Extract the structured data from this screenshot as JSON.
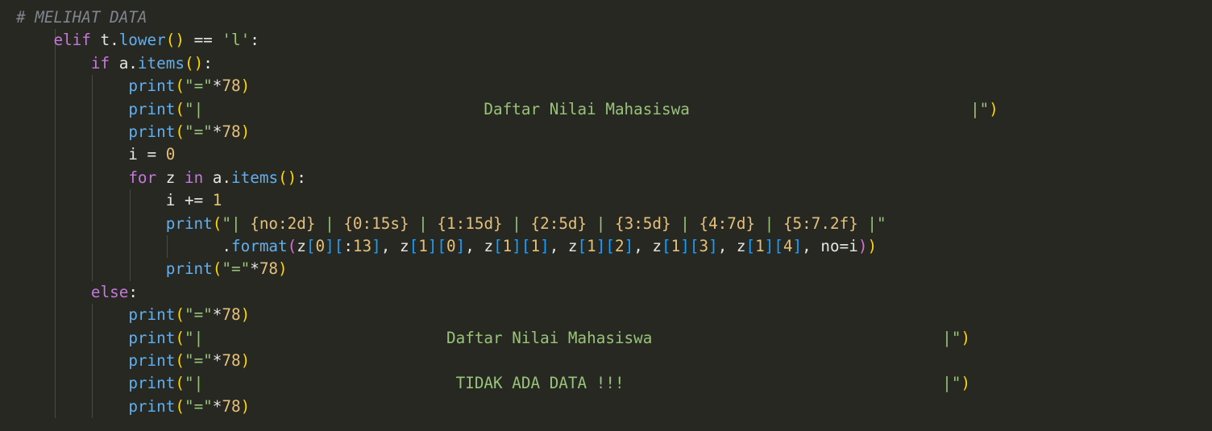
{
  "theme": {
    "background": "#272822",
    "indent_guide": "#4a4a40",
    "token_colors": {
      "keyword": "#c678dd",
      "function": "#61afef",
      "identifier": "#e5e5e5",
      "number": "#e5c07b",
      "string": "#98c379",
      "bracket_1": "#ffd700",
      "bracket_2": "#da70d6",
      "bracket_3": "#179fff",
      "comment": "#7f848e"
    }
  },
  "code": {
    "lines": [
      [
        {
          "t": "# MELIHAT DATA",
          "c": "#7f848e",
          "i": true
        }
      ],
      [
        {
          "t": "    ",
          "c": "#e5e5e5"
        },
        {
          "t": "elif",
          "c": "#c678dd"
        },
        {
          "t": " t.",
          "c": "#e5e5e5"
        },
        {
          "t": "lower",
          "c": "#61afef"
        },
        {
          "t": "()",
          "c": "#ffd700"
        },
        {
          "t": " == ",
          "c": "#e5e5e5"
        },
        {
          "t": "'l'",
          "c": "#98c379"
        },
        {
          "t": ":",
          "c": "#e5e5e5"
        }
      ],
      [
        {
          "t": "        ",
          "c": "#e5e5e5"
        },
        {
          "t": "if",
          "c": "#c678dd"
        },
        {
          "t": " a.",
          "c": "#e5e5e5"
        },
        {
          "t": "items",
          "c": "#61afef"
        },
        {
          "t": "()",
          "c": "#ffd700"
        },
        {
          "t": ":",
          "c": "#e5e5e5"
        }
      ],
      [
        {
          "t": "            ",
          "c": "#e5e5e5"
        },
        {
          "t": "print",
          "c": "#61afef"
        },
        {
          "t": "(",
          "c": "#ffd700"
        },
        {
          "t": "\"=\"",
          "c": "#98c379"
        },
        {
          "t": "*",
          "c": "#e5e5e5"
        },
        {
          "t": "78",
          "c": "#e5c07b"
        },
        {
          "t": ")",
          "c": "#ffd700"
        }
      ],
      [
        {
          "t": "            ",
          "c": "#e5e5e5"
        },
        {
          "t": "print",
          "c": "#61afef"
        },
        {
          "t": "(",
          "c": "#ffd700"
        },
        {
          "t": "\"|                              Daftar Nilai Mahasiswa                              |\"",
          "c": "#98c379"
        },
        {
          "t": ")",
          "c": "#ffd700"
        }
      ],
      [
        {
          "t": "            ",
          "c": "#e5e5e5"
        },
        {
          "t": "print",
          "c": "#61afef"
        },
        {
          "t": "(",
          "c": "#ffd700"
        },
        {
          "t": "\"=\"",
          "c": "#98c379"
        },
        {
          "t": "*",
          "c": "#e5e5e5"
        },
        {
          "t": "78",
          "c": "#e5c07b"
        },
        {
          "t": ")",
          "c": "#ffd700"
        }
      ],
      [
        {
          "t": "            i = ",
          "c": "#e5e5e5"
        },
        {
          "t": "0",
          "c": "#e5c07b"
        }
      ],
      [
        {
          "t": "            ",
          "c": "#e5e5e5"
        },
        {
          "t": "for",
          "c": "#c678dd"
        },
        {
          "t": " z ",
          "c": "#e5e5e5"
        },
        {
          "t": "in",
          "c": "#c678dd"
        },
        {
          "t": " a.",
          "c": "#e5e5e5"
        },
        {
          "t": "items",
          "c": "#61afef"
        },
        {
          "t": "()",
          "c": "#ffd700"
        },
        {
          "t": ":",
          "c": "#e5e5e5"
        }
      ],
      [
        {
          "t": "                i += ",
          "c": "#e5e5e5"
        },
        {
          "t": "1",
          "c": "#e5c07b"
        }
      ],
      [
        {
          "t": "                ",
          "c": "#e5e5e5"
        },
        {
          "t": "print",
          "c": "#61afef"
        },
        {
          "t": "(",
          "c": "#ffd700"
        },
        {
          "t": "\"| ",
          "c": "#98c379"
        },
        {
          "t": "{no:2d}",
          "c": "#e5c07b"
        },
        {
          "t": " | ",
          "c": "#98c379"
        },
        {
          "t": "{0:15s}",
          "c": "#e5c07b"
        },
        {
          "t": " | ",
          "c": "#98c379"
        },
        {
          "t": "{1:15d}",
          "c": "#e5c07b"
        },
        {
          "t": " | ",
          "c": "#98c379"
        },
        {
          "t": "{2:5d}",
          "c": "#e5c07b"
        },
        {
          "t": " | ",
          "c": "#98c379"
        },
        {
          "t": "{3:5d}",
          "c": "#e5c07b"
        },
        {
          "t": " | ",
          "c": "#98c379"
        },
        {
          "t": "{4:7d}",
          "c": "#e5c07b"
        },
        {
          "t": " | ",
          "c": "#98c379"
        },
        {
          "t": "{5:7.2f}",
          "c": "#e5c07b"
        },
        {
          "t": " |\"",
          "c": "#98c379"
        }
      ],
      [
        {
          "t": "                      .",
          "c": "#e5e5e5"
        },
        {
          "t": "format",
          "c": "#61afef"
        },
        {
          "t": "(",
          "c": "#da70d6"
        },
        {
          "t": "z",
          "c": "#e5e5e5"
        },
        {
          "t": "[",
          "c": "#179fff"
        },
        {
          "t": "0",
          "c": "#e5c07b"
        },
        {
          "t": "]",
          "c": "#179fff"
        },
        {
          "t": "[",
          "c": "#179fff"
        },
        {
          "t": ":",
          "c": "#e5e5e5"
        },
        {
          "t": "13",
          "c": "#e5c07b"
        },
        {
          "t": "]",
          "c": "#179fff"
        },
        {
          "t": ", z",
          "c": "#e5e5e5"
        },
        {
          "t": "[",
          "c": "#179fff"
        },
        {
          "t": "1",
          "c": "#e5c07b"
        },
        {
          "t": "]",
          "c": "#179fff"
        },
        {
          "t": "[",
          "c": "#179fff"
        },
        {
          "t": "0",
          "c": "#e5c07b"
        },
        {
          "t": "]",
          "c": "#179fff"
        },
        {
          "t": ", z",
          "c": "#e5e5e5"
        },
        {
          "t": "[",
          "c": "#179fff"
        },
        {
          "t": "1",
          "c": "#e5c07b"
        },
        {
          "t": "]",
          "c": "#179fff"
        },
        {
          "t": "[",
          "c": "#179fff"
        },
        {
          "t": "1",
          "c": "#e5c07b"
        },
        {
          "t": "]",
          "c": "#179fff"
        },
        {
          "t": ", z",
          "c": "#e5e5e5"
        },
        {
          "t": "[",
          "c": "#179fff"
        },
        {
          "t": "1",
          "c": "#e5c07b"
        },
        {
          "t": "]",
          "c": "#179fff"
        },
        {
          "t": "[",
          "c": "#179fff"
        },
        {
          "t": "2",
          "c": "#e5c07b"
        },
        {
          "t": "]",
          "c": "#179fff"
        },
        {
          "t": ", z",
          "c": "#e5e5e5"
        },
        {
          "t": "[",
          "c": "#179fff"
        },
        {
          "t": "1",
          "c": "#e5c07b"
        },
        {
          "t": "]",
          "c": "#179fff"
        },
        {
          "t": "[",
          "c": "#179fff"
        },
        {
          "t": "3",
          "c": "#e5c07b"
        },
        {
          "t": "]",
          "c": "#179fff"
        },
        {
          "t": ", z",
          "c": "#e5e5e5"
        },
        {
          "t": "[",
          "c": "#179fff"
        },
        {
          "t": "1",
          "c": "#e5c07b"
        },
        {
          "t": "]",
          "c": "#179fff"
        },
        {
          "t": "[",
          "c": "#179fff"
        },
        {
          "t": "4",
          "c": "#e5c07b"
        },
        {
          "t": "]",
          "c": "#179fff"
        },
        {
          "t": ", no=i",
          "c": "#e5e5e5"
        },
        {
          "t": ")",
          "c": "#da70d6"
        },
        {
          "t": ")",
          "c": "#ffd700"
        }
      ],
      [
        {
          "t": "                ",
          "c": "#e5e5e5"
        },
        {
          "t": "print",
          "c": "#61afef"
        },
        {
          "t": "(",
          "c": "#ffd700"
        },
        {
          "t": "\"=\"",
          "c": "#98c379"
        },
        {
          "t": "*",
          "c": "#e5e5e5"
        },
        {
          "t": "78",
          "c": "#e5c07b"
        },
        {
          "t": ")",
          "c": "#ffd700"
        }
      ],
      [
        {
          "t": "        ",
          "c": "#e5e5e5"
        },
        {
          "t": "else",
          "c": "#c678dd"
        },
        {
          "t": ":",
          "c": "#e5e5e5"
        }
      ],
      [
        {
          "t": "            ",
          "c": "#e5e5e5"
        },
        {
          "t": "print",
          "c": "#61afef"
        },
        {
          "t": "(",
          "c": "#ffd700"
        },
        {
          "t": "\"=\"",
          "c": "#98c379"
        },
        {
          "t": "*",
          "c": "#e5e5e5"
        },
        {
          "t": "78",
          "c": "#e5c07b"
        },
        {
          "t": ")",
          "c": "#ffd700"
        }
      ],
      [
        {
          "t": "            ",
          "c": "#e5e5e5"
        },
        {
          "t": "print",
          "c": "#61afef"
        },
        {
          "t": "(",
          "c": "#ffd700"
        },
        {
          "t": "\"|                          Daftar Nilai Mahasiswa                               |\"",
          "c": "#98c379"
        },
        {
          "t": ")",
          "c": "#ffd700"
        }
      ],
      [
        {
          "t": "            ",
          "c": "#e5e5e5"
        },
        {
          "t": "print",
          "c": "#61afef"
        },
        {
          "t": "(",
          "c": "#ffd700"
        },
        {
          "t": "\"=\"",
          "c": "#98c379"
        },
        {
          "t": "*",
          "c": "#e5e5e5"
        },
        {
          "t": "78",
          "c": "#e5c07b"
        },
        {
          "t": ")",
          "c": "#ffd700"
        }
      ],
      [
        {
          "t": "            ",
          "c": "#e5e5e5"
        },
        {
          "t": "print",
          "c": "#61afef"
        },
        {
          "t": "(",
          "c": "#ffd700"
        },
        {
          "t": "\"|                           TIDAK ADA DATA !!!                                  |\"",
          "c": "#98c379"
        },
        {
          "t": ")",
          "c": "#ffd700"
        }
      ],
      [
        {
          "t": "            ",
          "c": "#e5e5e5"
        },
        {
          "t": "print",
          "c": "#61afef"
        },
        {
          "t": "(",
          "c": "#ffd700"
        },
        {
          "t": "\"=\"",
          "c": "#98c379"
        },
        {
          "t": "*",
          "c": "#e5e5e5"
        },
        {
          "t": "78",
          "c": "#e5c07b"
        },
        {
          "t": ")",
          "c": "#ffd700"
        }
      ]
    ]
  }
}
